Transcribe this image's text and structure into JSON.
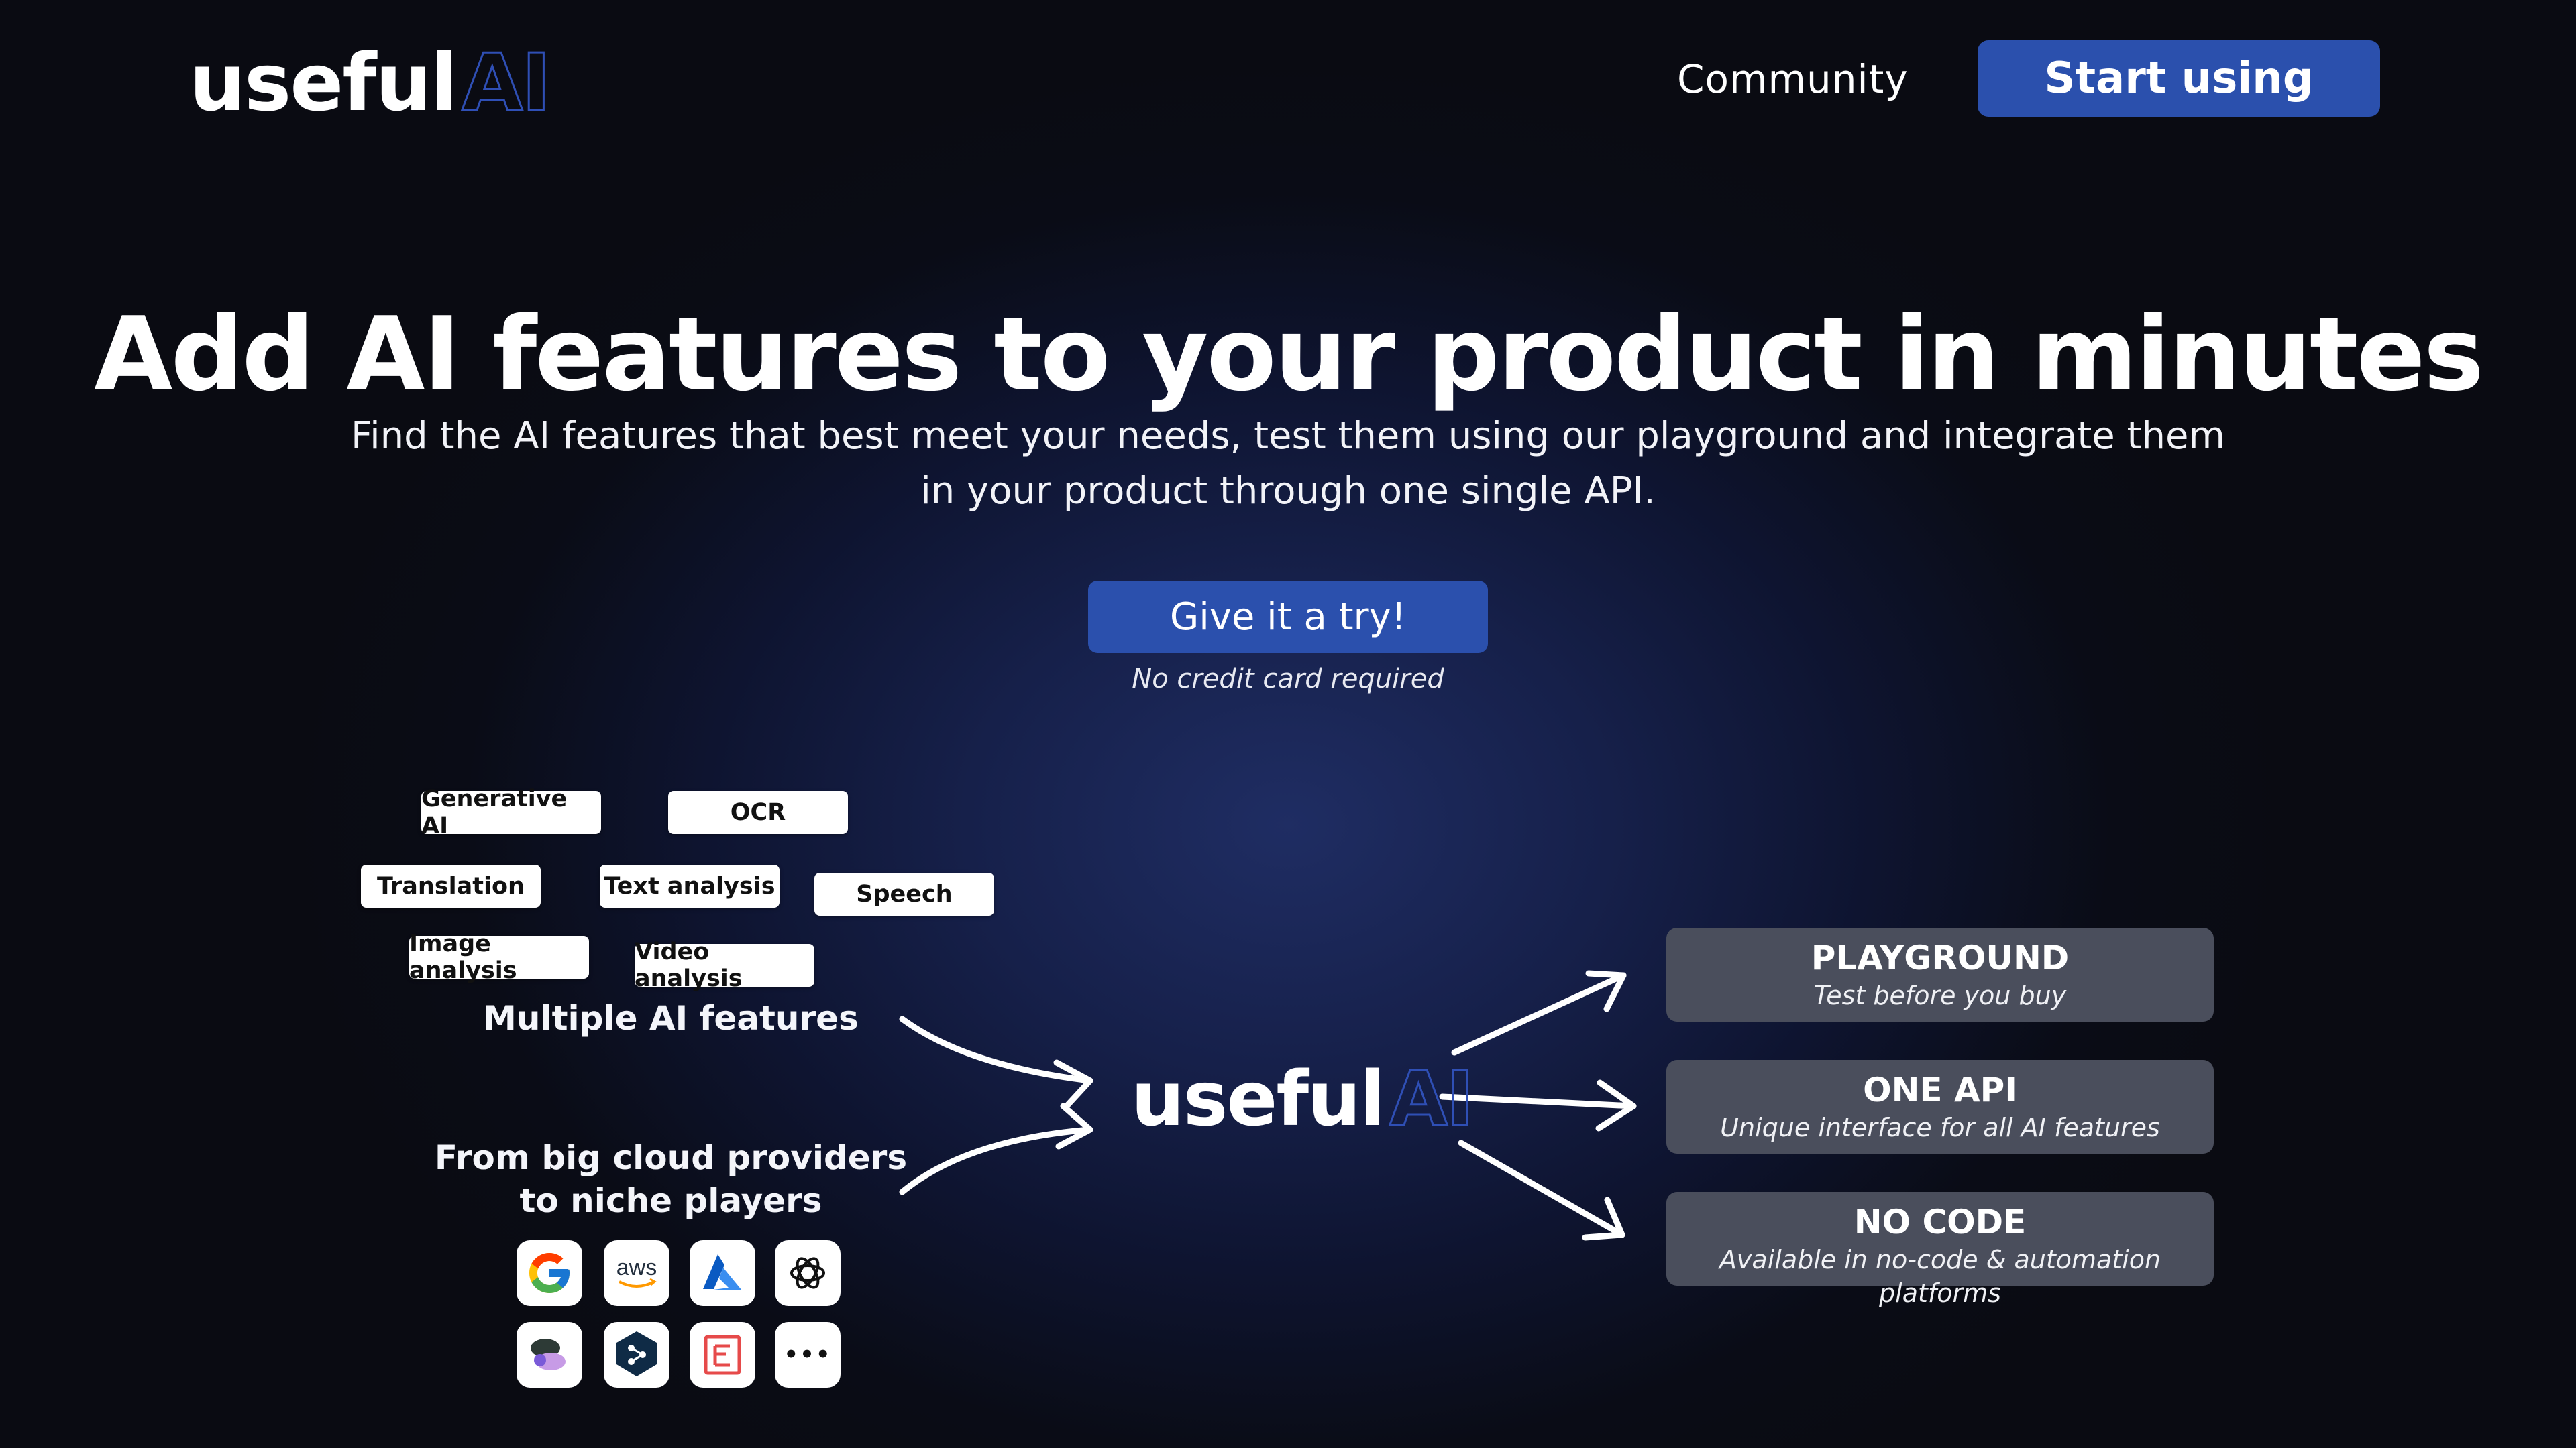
{
  "header": {
    "logo": {
      "word": "useful",
      "ai": "AI"
    },
    "nav_community": "Community",
    "cta_start": "Start using"
  },
  "hero": {
    "title": "Add AI features to your product in minutes",
    "subtitle": "Find the AI features that best meet your needs, test them using our playground and integrate them in your product through one single API.",
    "cta_try": "Give it a try!",
    "cta_note": "No credit card required"
  },
  "features": {
    "tags": [
      "Generative AI",
      "OCR",
      "Translation",
      "Text analysis",
      "Speech",
      "Image analysis",
      "Video analysis"
    ],
    "label": "Multiple AI features"
  },
  "providers": {
    "label_line1": "From big cloud providers",
    "label_line2": "to niche players",
    "icons": [
      "google-icon",
      "aws-icon",
      "azure-icon",
      "openai-icon",
      "assemblyai-icon",
      "deepl-icon",
      "mindee-icon",
      "more-icon"
    ],
    "aws_text": "aws",
    "more_text": "•••"
  },
  "center_logo": {
    "word": "useful",
    "ai": "AI"
  },
  "cards": [
    {
      "title": "PLAYGROUND",
      "subtitle": "Test before you buy"
    },
    {
      "title": "ONE API",
      "subtitle": "Unique interface for all AI features"
    },
    {
      "title": "NO CODE",
      "subtitle": "Available in no-code & automation platforms"
    }
  ],
  "colors": {
    "accent": "#2b50ad",
    "logo_ai": "#2f4fb5",
    "background": "#0a0b12",
    "card": "#4a4e5c"
  }
}
